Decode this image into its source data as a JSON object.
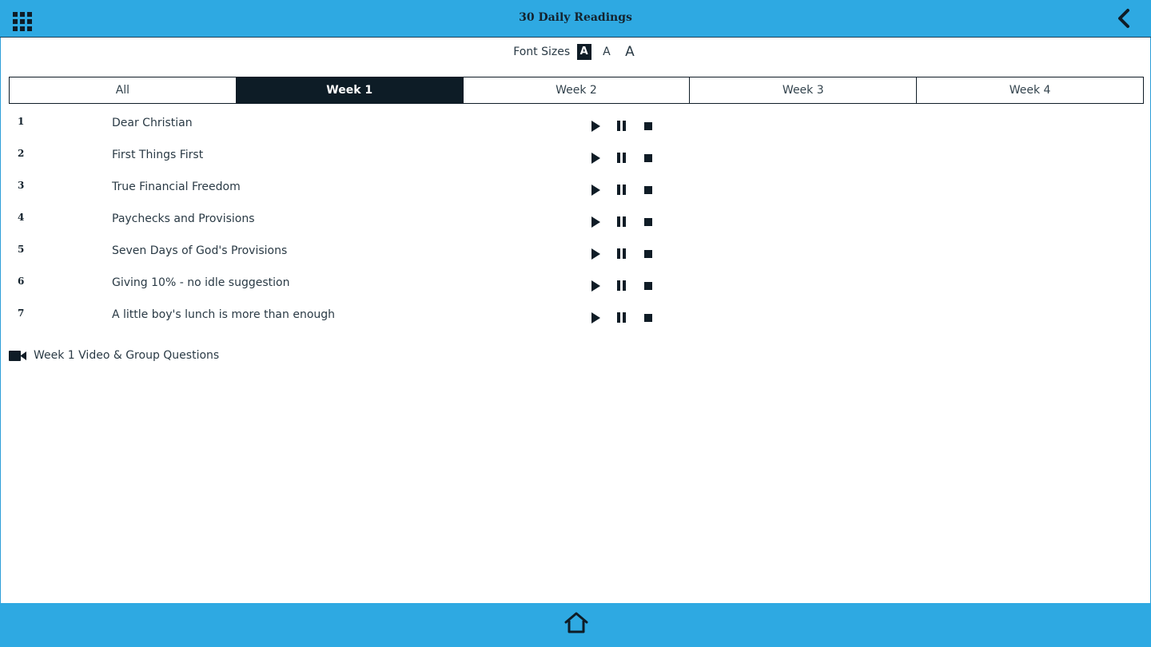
{
  "header": {
    "title": "30 Daily Readings",
    "menu_icon": "grid-menu-icon",
    "back_icon": "chevron-left-icon",
    "bar_color": "#2ea9e2"
  },
  "font_sizes": {
    "label": "Font Sizes",
    "options": [
      "A",
      "A",
      "A"
    ],
    "selected_index": 0
  },
  "tabs": [
    {
      "label": "All",
      "active": false
    },
    {
      "label": "Week 1",
      "active": true
    },
    {
      "label": "Week 2",
      "active": false
    },
    {
      "label": "Week 3",
      "active": false
    },
    {
      "label": "Week 4",
      "active": false
    }
  ],
  "readings": [
    {
      "number": "1",
      "title": "Dear Christian"
    },
    {
      "number": "2",
      "title": "First Things First"
    },
    {
      "number": "3",
      "title": "True Financial Freedom"
    },
    {
      "number": "4",
      "title": "Paychecks and Provisions"
    },
    {
      "number": "5",
      "title": "Seven Days of God's Provisions"
    },
    {
      "number": "6",
      "title": "Giving 10% - no idle suggestion"
    },
    {
      "number": "7",
      "title": "A little boy's lunch is more than enough"
    }
  ],
  "media_controls": [
    "play-icon",
    "pause-icon",
    "stop-icon"
  ],
  "video_link": {
    "label": "Week 1 Video & Group Questions",
    "icon": "video-camera-icon"
  },
  "footer": {
    "home_icon": "home-icon"
  },
  "colors": {
    "accent": "#2ea9e2",
    "dark": "#0d1c26"
  }
}
